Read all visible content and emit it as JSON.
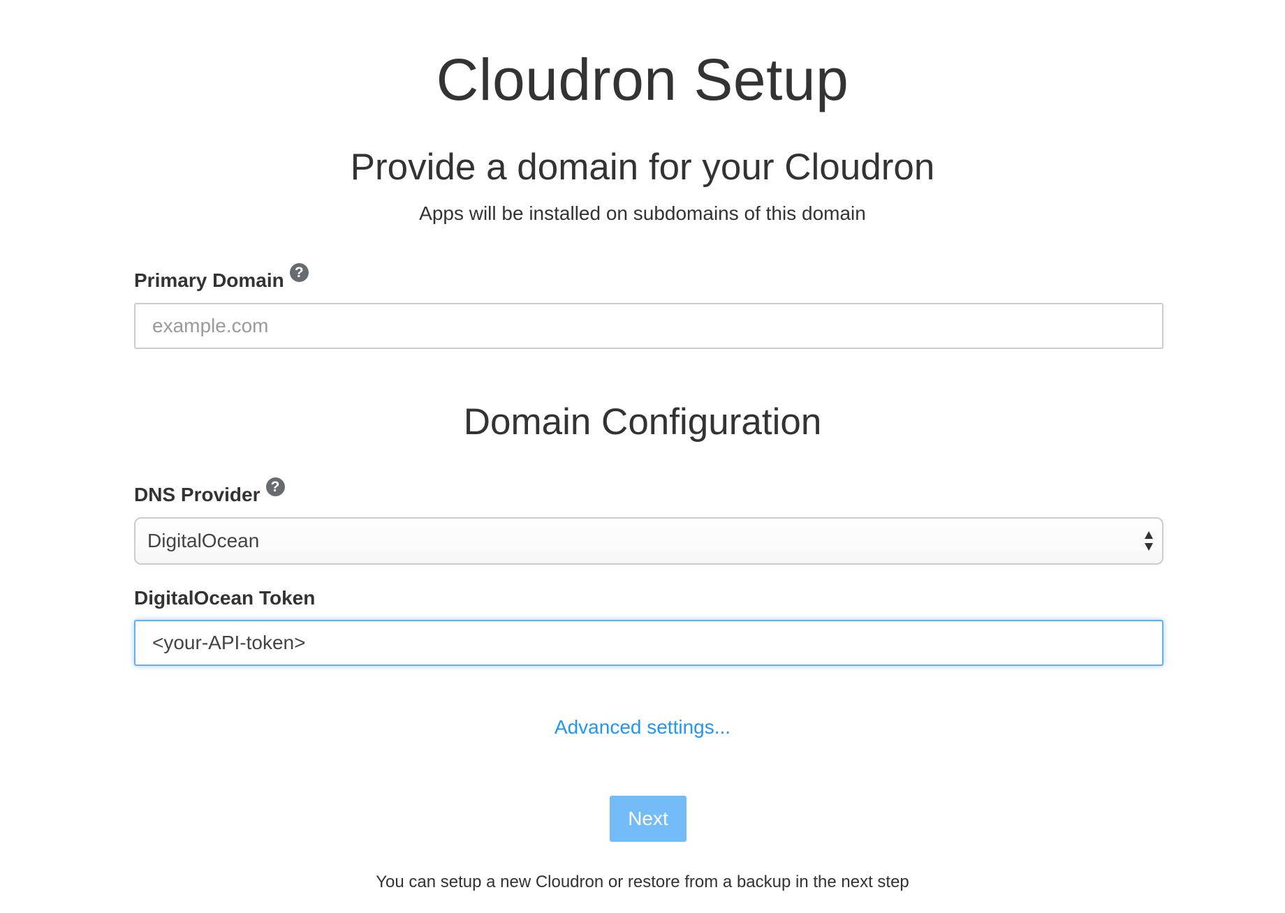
{
  "header": {
    "title": "Cloudron Setup"
  },
  "domain_section": {
    "title": "Provide a domain for your Cloudron",
    "subtitle": "Apps will be installed on subdomains of this domain",
    "primary_domain_label": "Primary Domain",
    "primary_domain_placeholder": "example.com",
    "primary_domain_value": ""
  },
  "config_section": {
    "title": "Domain Configuration",
    "dns_provider_label": "DNS Provider",
    "dns_provider_selected": "DigitalOcean",
    "token_label": "DigitalOcean Token",
    "token_value": "<your-API-token>"
  },
  "icons": {
    "help": "question-circle-icon",
    "select_arrows": "updown-arrows-icon"
  },
  "help_glyph": "?",
  "advanced_link": "Advanced settings...",
  "next_button": "Next",
  "footer_note": "You can setup a new Cloudron or restore from a backup in the next step",
  "colors": {
    "link": "#2196f3",
    "button": "#73bcf8",
    "focus_border": "#66afe9"
  }
}
